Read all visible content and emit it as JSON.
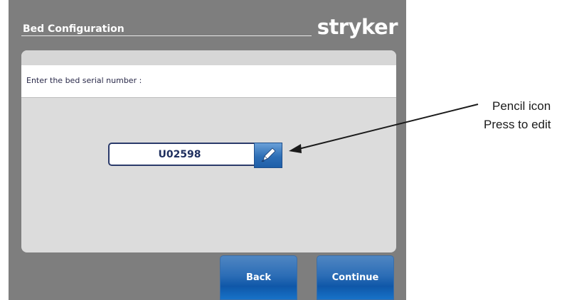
{
  "header": {
    "title": "Bed Configuration",
    "brand": "stryker"
  },
  "prompt": {
    "text": "Enter the bed serial number :"
  },
  "serial": {
    "value": "U02598"
  },
  "edit_button": {
    "icon": "pencil-icon"
  },
  "footer": {
    "back_label": "Back",
    "continue_label": "Continue"
  },
  "annotation": {
    "line1": "Pencil icon",
    "line2": "Press to edit"
  },
  "colors": {
    "screen_background": "#7e7e7e",
    "panel_background": "#dcdcdc",
    "button_blue": "#2c6db6",
    "field_border": "#2a3a6a"
  }
}
